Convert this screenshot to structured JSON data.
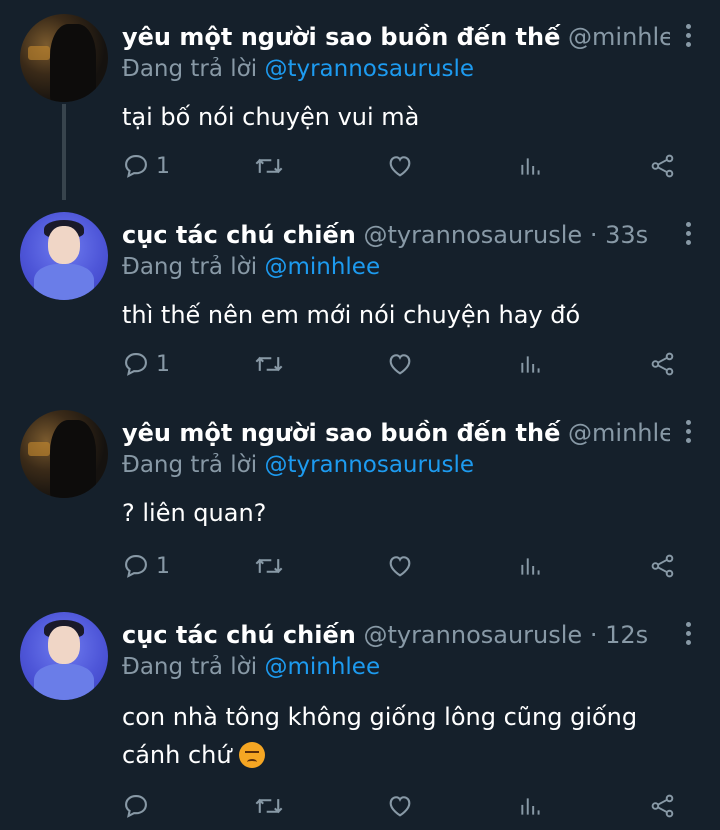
{
  "tweets": [
    {
      "name": "yêu một người sao buồn đến thế",
      "handle": "@minhlee ·...",
      "replying_label": "Đang trả lời",
      "replying_to": "@tyrannosaurusle",
      "text": "tại bố nói chuyện vui mà",
      "reply_count": "1",
      "avatar": "dark"
    },
    {
      "name": "cục tác chú chiến",
      "handle": "@tyrannosaurusle · 33s",
      "replying_label": "Đang trả lời",
      "replying_to": "@minhlee",
      "text": "thì thế nên em mới nói chuyện hay đó",
      "reply_count": "1",
      "avatar": "blue"
    },
    {
      "name": "yêu một người sao buồn đến thế",
      "handle": "@minhlee ·...",
      "replying_label": "Đang trả lời",
      "replying_to": "@tyrannosaurusle",
      "text": "? liên quan?",
      "reply_count": "1",
      "avatar": "dark"
    },
    {
      "name": "cục tác chú chiến",
      "handle": "@tyrannosaurusle · 12s",
      "replying_label": "Đang trả lời",
      "replying_to": "@minhlee",
      "text": "con nhà tông không giống lông cũng giống cánh chứ",
      "reply_count": "",
      "avatar": "blue"
    }
  ],
  "icons": {
    "reply": "reply-icon",
    "retweet": "retweet-icon",
    "like": "heart-icon",
    "analytics": "analytics-icon",
    "share": "share-icon",
    "more": "more-options-icon",
    "emoji": "angry-face-emoji"
  },
  "colors": {
    "background": "#15202b",
    "link": "#1d9bf0",
    "muted": "#8899a6"
  }
}
